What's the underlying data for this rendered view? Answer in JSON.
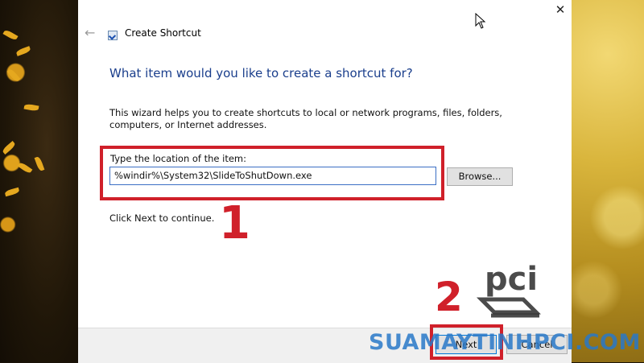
{
  "window": {
    "title": "Create Shortcut",
    "close_glyph": "✕",
    "back_glyph": "←"
  },
  "wizard": {
    "heading": "What item would you like to create a shortcut for?",
    "description": "This wizard helps you to create shortcuts to local or network programs, files, folders, computers, or Internet addresses.",
    "location_label": "Type the location of the item:",
    "location_value": "%windir%\\System32\\SlideToShutDown.exe",
    "browse_label": "Browse...",
    "hint": "Click Next to continue."
  },
  "footer": {
    "next_label": "Next",
    "cancel_label": "Cancel"
  },
  "annotations": {
    "step_1": "1",
    "step_2": "2",
    "highlight_color": "#d0202a"
  },
  "watermark": {
    "logo_text": "pci",
    "site_text": "SUAMAYTINHPCI.COM"
  },
  "icons": {
    "back": "back-arrow-icon",
    "close": "close-icon",
    "app": "shortcut-icon",
    "cursor": "mouse-cursor-icon"
  }
}
